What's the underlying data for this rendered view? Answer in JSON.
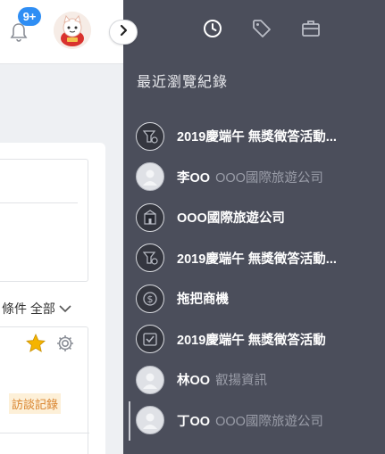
{
  "header": {
    "notification_badge": "9+",
    "bell_icon": "bell-icon",
    "avatar_icon": "lucky-cat-avatar",
    "expand_icon": "chevron-right-icon"
  },
  "card": {
    "filter_label": "條件 全部",
    "visit_tag": "訪談記錄",
    "star_icon": "star-icon",
    "gear_icon": "gear-icon"
  },
  "drawer": {
    "tabs": [
      {
        "icon": "clock-icon",
        "active": true
      },
      {
        "icon": "tag-icon",
        "active": false
      },
      {
        "icon": "briefcase-icon",
        "active": false
      }
    ],
    "section_title": "最近瀏覽紀錄",
    "history": [
      {
        "name": "2019慶端午 無獎徵答活動...",
        "sub": "",
        "icon": "campaign-icon"
      },
      {
        "name": "李OO",
        "sub": "OOO國際旅遊公司",
        "icon": "person-icon"
      },
      {
        "name": "OOO國際旅遊公司",
        "sub": "",
        "icon": "company-icon"
      },
      {
        "name": "2019慶端午 無獎徵答活動...",
        "sub": "",
        "icon": "campaign-icon"
      },
      {
        "name": "拖把商機",
        "sub": "",
        "icon": "dollar-icon"
      },
      {
        "name": "2019慶端午 無獎徵答活動",
        "sub": "",
        "icon": "checkbox-calendar-icon"
      },
      {
        "name": "林OO",
        "sub": "叡揚資訊",
        "icon": "person-icon"
      },
      {
        "name": "丁OO",
        "sub": "OOO國際旅遊公司",
        "icon": "person-icon"
      }
    ]
  },
  "colors": {
    "drawer_bg": "#4b4e5b",
    "badge": "#2f8ef4",
    "tag_bg": "#fdf0d8",
    "tag_text": "#d9822b",
    "star": "#f5b400"
  }
}
